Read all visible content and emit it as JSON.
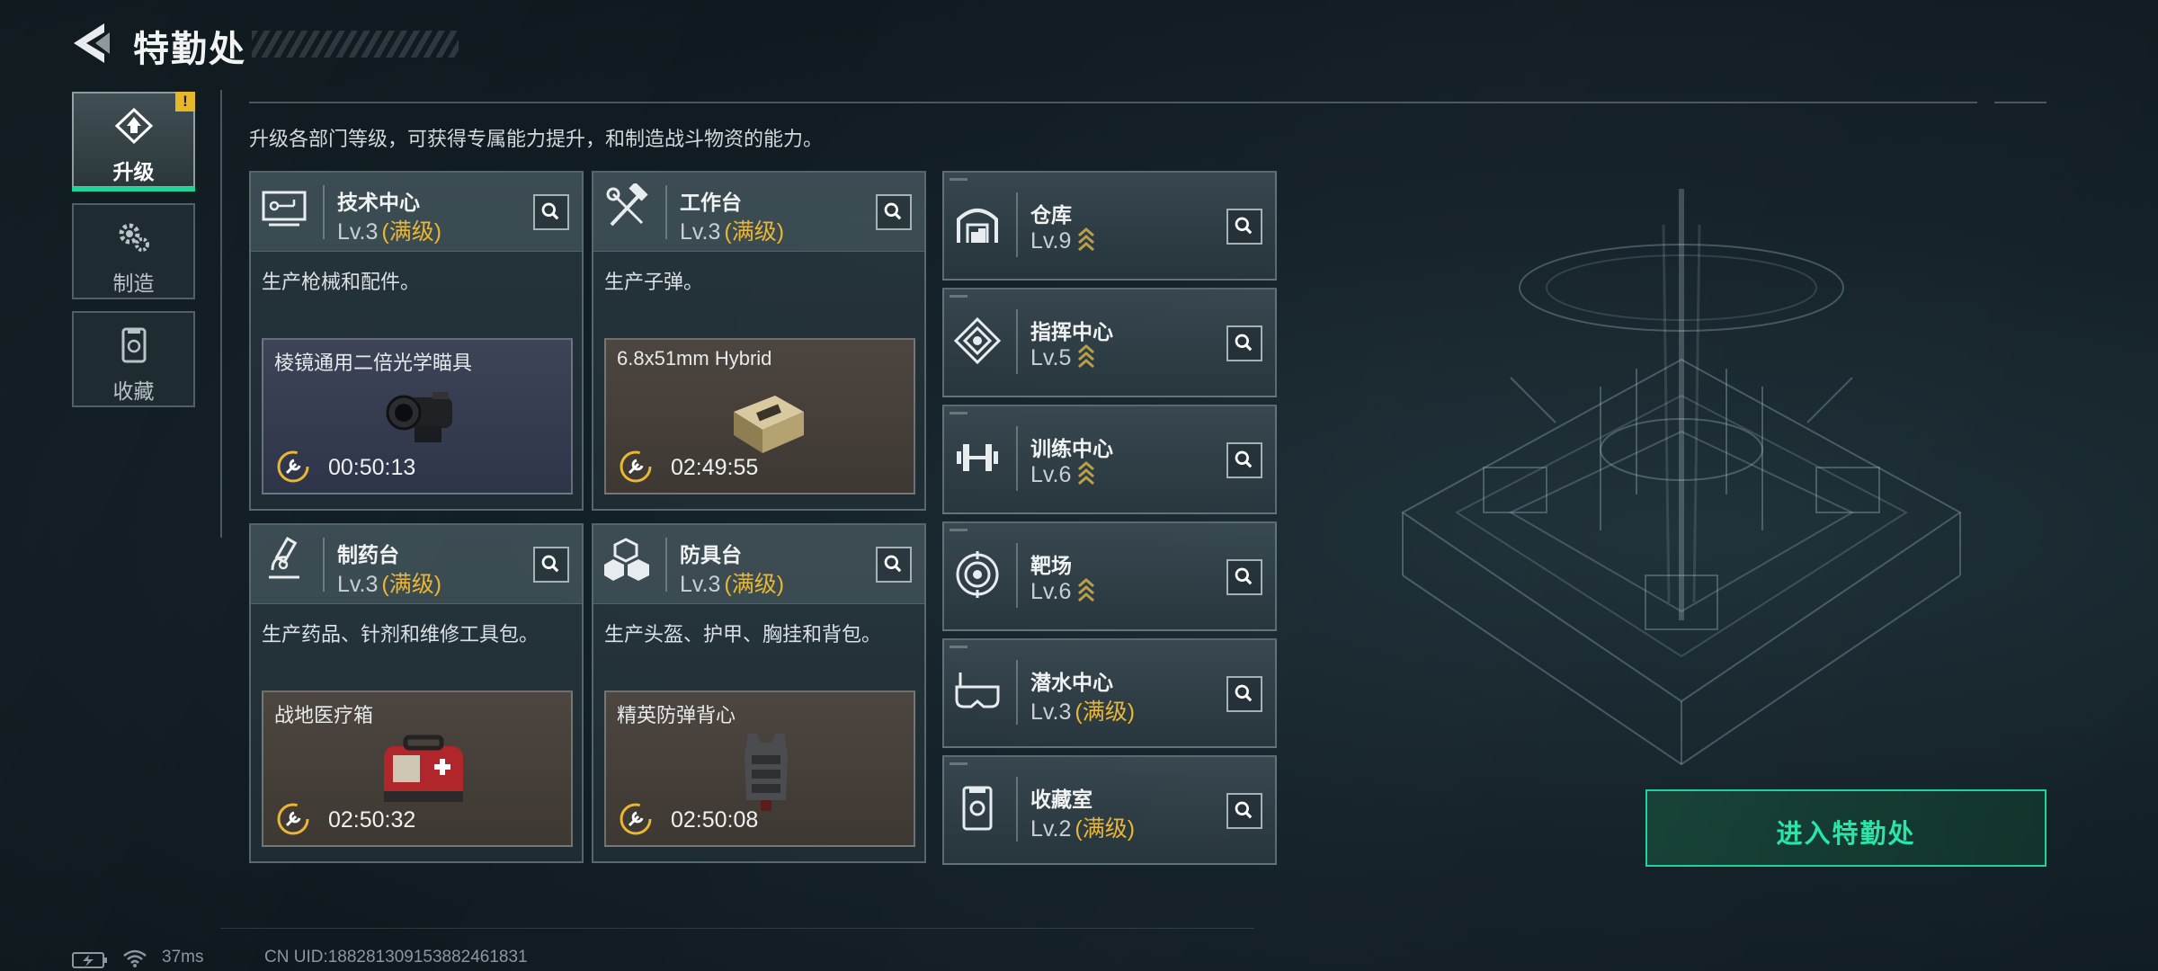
{
  "header": {
    "title": "特勤处"
  },
  "nav": {
    "items": [
      {
        "label": "升级",
        "icon": "upgrade-icon",
        "active": true,
        "badge": "!"
      },
      {
        "label": "制造",
        "icon": "gears-icon",
        "active": false
      },
      {
        "label": "收藏",
        "icon": "collection-icon",
        "active": false
      }
    ]
  },
  "description": "升级各部门等级，可获得专属能力提升，和制造战斗物资的能力。",
  "departments": [
    {
      "name": "技术中心",
      "level": "Lv.3",
      "max_tag": "(满级)",
      "desc": "生产枪械和配件。",
      "craft_name": "棱镜通用二倍光学瞄具",
      "timer": "00:50:13",
      "icon": "tech-center-icon"
    },
    {
      "name": "工作台",
      "level": "Lv.3",
      "max_tag": "(满级)",
      "desc": "生产子弹。",
      "craft_name": "6.8x51mm Hybrid",
      "timer": "02:49:55",
      "icon": "workbench-icon"
    },
    {
      "name": "制药台",
      "level": "Lv.3",
      "max_tag": "(满级)",
      "desc": "生产药品、针剂和维修工具包。",
      "craft_name": "战地医疗箱",
      "timer": "02:50:32",
      "icon": "pharmacy-icon"
    },
    {
      "name": "防具台",
      "level": "Lv.3",
      "max_tag": "(满级)",
      "desc": "生产头盔、护甲、胸挂和背包。",
      "craft_name": "精英防弹背心",
      "timer": "02:50:08",
      "icon": "armor-bench-icon"
    }
  ],
  "mini_departments": [
    {
      "name": "仓库",
      "level": "Lv.9",
      "max_tag": "",
      "upgradable": true,
      "icon": "warehouse-icon"
    },
    {
      "name": "指挥中心",
      "level": "Lv.5",
      "max_tag": "",
      "upgradable": true,
      "icon": "command-center-icon"
    },
    {
      "name": "训练中心",
      "level": "Lv.6",
      "max_tag": "",
      "upgradable": true,
      "icon": "training-center-icon"
    },
    {
      "name": "靶场",
      "level": "Lv.6",
      "max_tag": "",
      "upgradable": true,
      "icon": "shooting-range-icon"
    },
    {
      "name": "潜水中心",
      "level": "Lv.3",
      "max_tag": "(满级)",
      "upgradable": false,
      "icon": "diving-center-icon"
    },
    {
      "name": "收藏室",
      "level": "Lv.2",
      "max_tag": "(满级)",
      "upgradable": false,
      "icon": "collection-room-icon"
    }
  ],
  "enter_button": "进入特勤处",
  "status": {
    "ping": "37ms",
    "uid": "CN UID:188281309153882461831"
  },
  "colors": {
    "accent_green": "#1fd39a",
    "max_level_gold": "#e9b733",
    "warning_yellow": "#e7b72b"
  }
}
